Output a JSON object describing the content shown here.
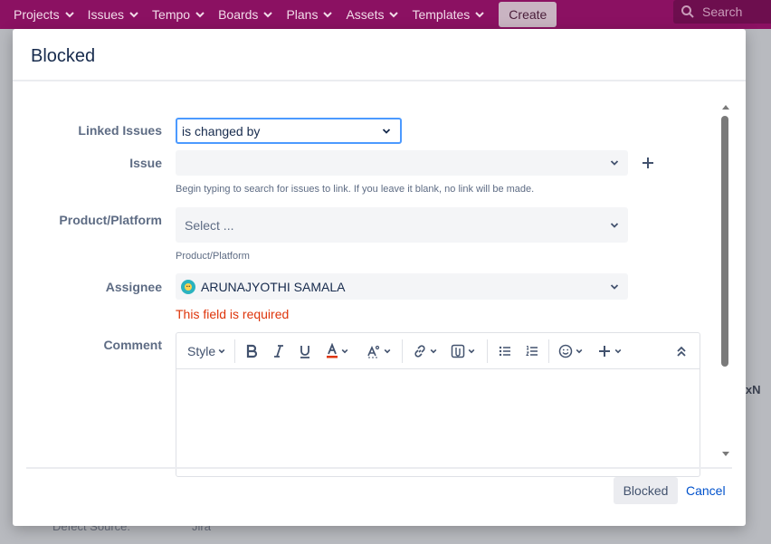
{
  "nav": {
    "items": [
      {
        "label": "Projects"
      },
      {
        "label": "Issues"
      },
      {
        "label": "Tempo"
      },
      {
        "label": "Boards"
      },
      {
        "label": "Plans"
      },
      {
        "label": "Assets"
      },
      {
        "label": "Templates"
      }
    ],
    "create_label": "Create",
    "search_placeholder": "Search"
  },
  "background": {
    "fragment_text": "th xN",
    "defect_source_label": "Defect Source:",
    "defect_source_value": "Jira"
  },
  "dialog": {
    "title": "Blocked",
    "linked_issues": {
      "label": "Linked Issues",
      "value": "is changed by"
    },
    "issue": {
      "label": "Issue",
      "value": "",
      "help": "Begin typing to search for issues to link. If you leave it blank, no link will be made."
    },
    "product_platform": {
      "label": "Product/Platform",
      "placeholder": "Select ...",
      "help": "Product/Platform"
    },
    "assignee": {
      "label": "Assignee",
      "value": "ARUNAJYOTHI SAMALA",
      "error": "This field is required"
    },
    "comment": {
      "label": "Comment",
      "toolbar": {
        "style_label": "Style"
      }
    },
    "footer": {
      "submit_label": "Blocked",
      "cancel_label": "Cancel"
    }
  },
  "colors": {
    "nav_bg": "#8b1162",
    "error": "#de350b",
    "link": "#0052cc",
    "focus_border": "#4c9aff"
  }
}
